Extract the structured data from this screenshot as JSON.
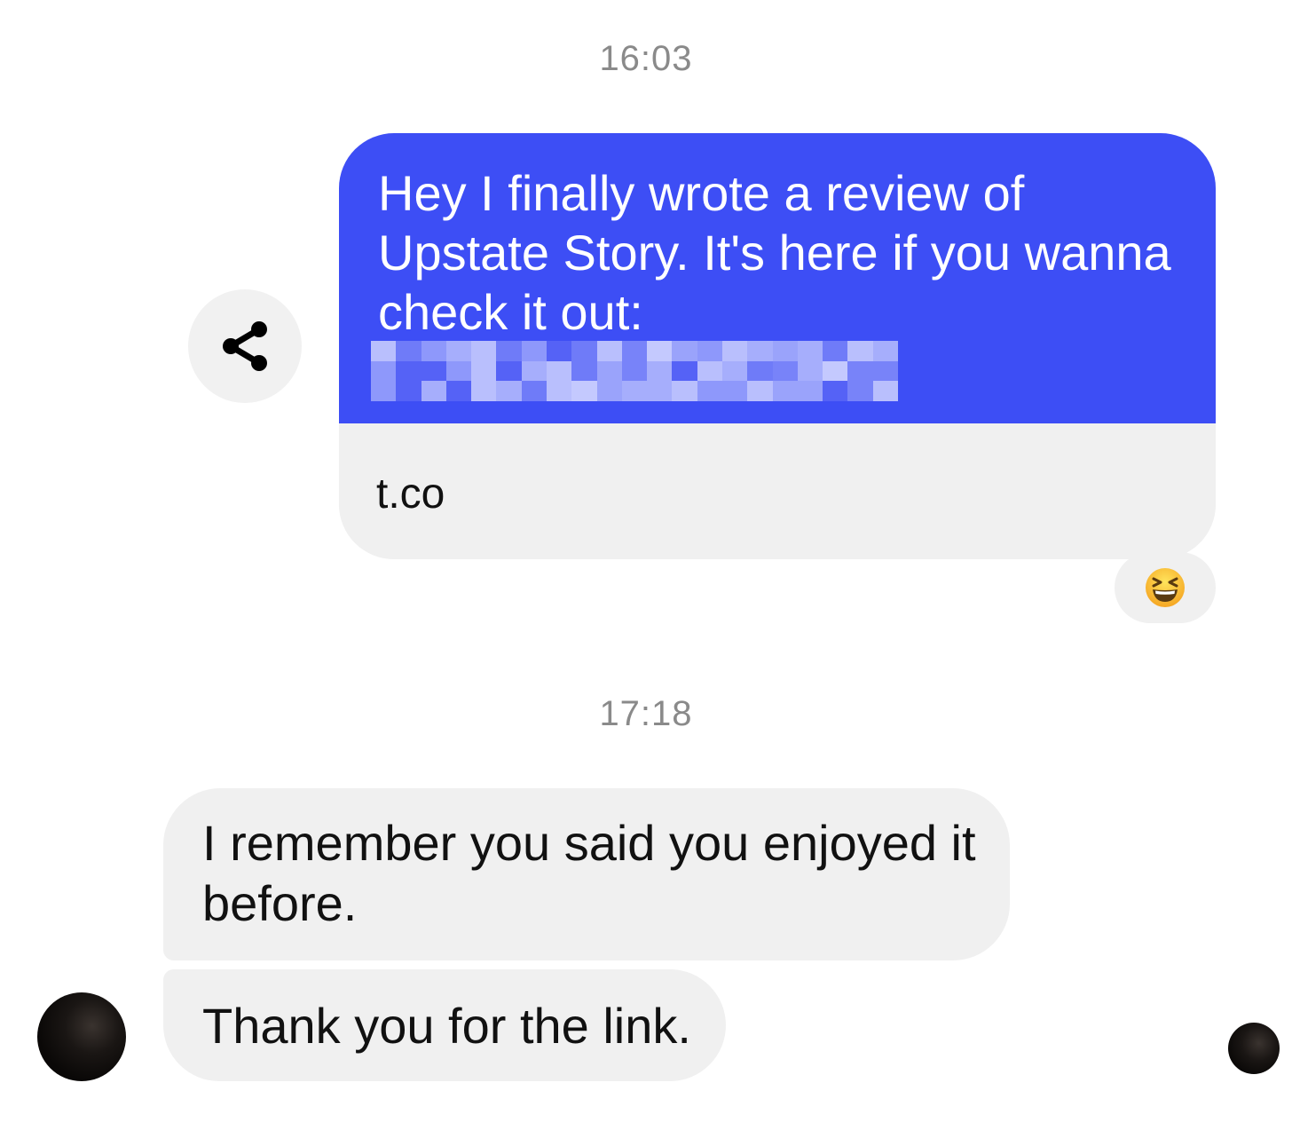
{
  "timestamps": [
    "16:03",
    "17:18"
  ],
  "outgoing": {
    "text": "Hey I finally wrote a review of Upstate Story. It's here if you wanna check it out:",
    "link_preview_domain": "t.co",
    "reaction_emoji": "laughing-face-emoji"
  },
  "incoming": [
    {
      "text": "I remember you said you enjoyed it before."
    },
    {
      "text": "Thank you for the link."
    }
  ],
  "icons": {
    "share": "share-icon",
    "avatar_contact": "contact-avatar",
    "avatar_seen": "seen-avatar"
  },
  "colors": {
    "outgoing_bubble": "#3d4ef5",
    "incoming_bubble": "#f0f0f0",
    "timestamp": "#8a8a8a"
  }
}
